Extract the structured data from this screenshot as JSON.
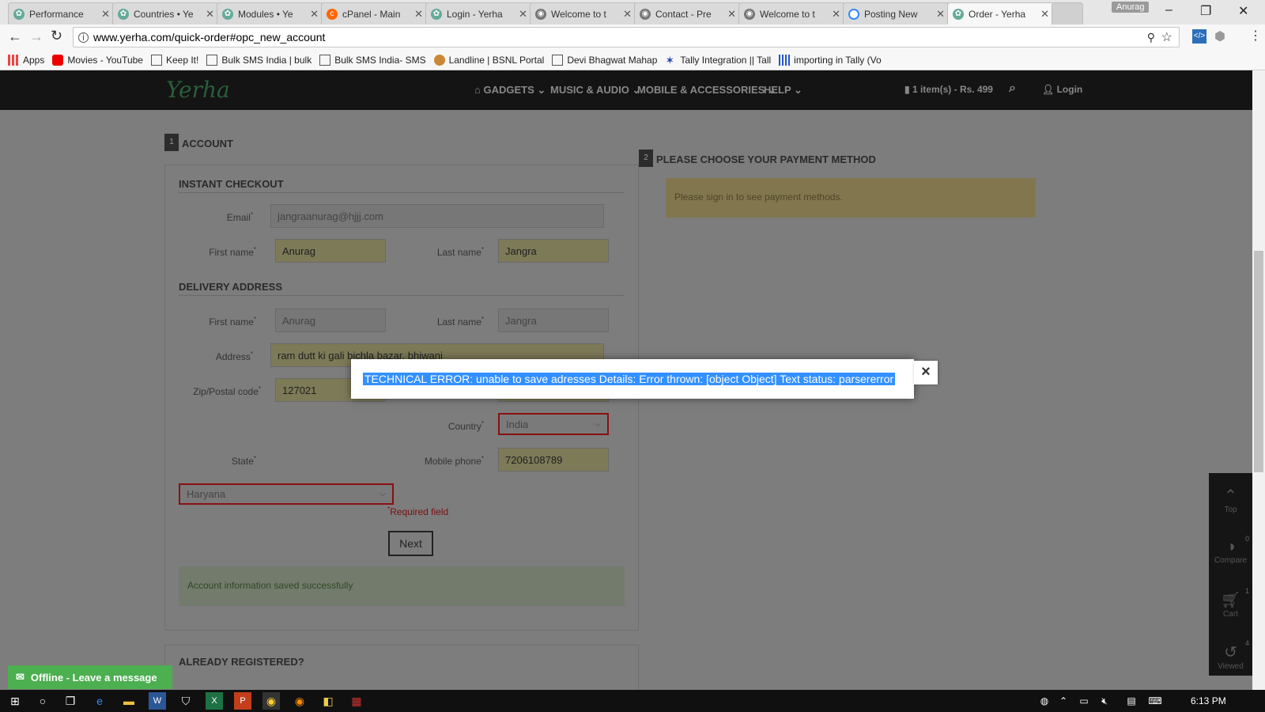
{
  "browser": {
    "tabs": [
      {
        "title": "Performance",
        "icon": "yerha-leaf",
        "color": "#6a9"
      },
      {
        "title": "Countries • Ye",
        "icon": "yerha-leaf",
        "color": "#6a9"
      },
      {
        "title": "Modules • Ye",
        "icon": "yerha-leaf",
        "color": "#6a9"
      },
      {
        "title": "cPanel - Main",
        "icon": "cpanel",
        "color": "#f60"
      },
      {
        "title": "Login - Yerha",
        "icon": "yerha-leaf",
        "color": "#6a9"
      },
      {
        "title": "Welcome to t",
        "icon": "globe",
        "color": "#777"
      },
      {
        "title": "Contact - Pre",
        "icon": "globe",
        "color": "#777"
      },
      {
        "title": "Welcome to t",
        "icon": "globe",
        "color": "#777"
      },
      {
        "title": "Posting New",
        "icon": "loading",
        "color": "#38f"
      },
      {
        "title": "Order - Yerha",
        "icon": "yerha-leaf",
        "color": "#6a9"
      }
    ],
    "profile_name": "Anurag",
    "url": "www.yerha.com/quick-order#opc_new_account",
    "bookmarks": [
      {
        "label": "Apps",
        "icon": "apps-grid"
      },
      {
        "label": "Movies - YouTube",
        "icon": "youtube"
      },
      {
        "label": "Keep It!",
        "icon": "page"
      },
      {
        "label": "Bulk SMS India | bulk",
        "icon": "page"
      },
      {
        "label": "Bulk SMS India- SMS",
        "icon": "page"
      },
      {
        "label": "Landline | BSNL Portal",
        "icon": "bsnl"
      },
      {
        "label": "Devi Bhagwat Mahap",
        "icon": "page"
      },
      {
        "label": "Tally Integration || Tall",
        "icon": "star-blue"
      },
      {
        "label": "importing in Tally (Vo",
        "icon": "bars-blue"
      }
    ]
  },
  "site": {
    "logo": "Yerha",
    "nav": [
      {
        "label": "GADGETS"
      },
      {
        "label": "MUSIC & AUDIO"
      },
      {
        "label": "MOBILE & ACCESSORIES"
      },
      {
        "label": "HELP"
      }
    ],
    "cart_summary": "1 item(s) - Rs. 499",
    "login_label": "Login"
  },
  "account": {
    "step_number": "1",
    "title": "ACCOUNT",
    "instant_checkout": "INSTANT CHECKOUT",
    "email_label": "Email",
    "email_value": "jangraanurag@hjjj.com",
    "first_name_label": "First name",
    "first_name_value": "Anurag",
    "last_name_label": "Last name",
    "last_name_value": "Jangra",
    "delivery_title": "DELIVERY ADDRESS",
    "d_first_name_label": "First name",
    "d_first_name_value": "Anurag",
    "d_last_name_label": "Last name",
    "d_last_name_value": "Jangra",
    "address_label": "Address",
    "address_value": "ram dutt ki gali bichla bazar, bhiwani",
    "zip_label": "Zip/Postal code",
    "zip_value": "127021",
    "country_label": "Country",
    "country_value": "India",
    "state_label": "State",
    "state_value": "Haryana",
    "mobile_label": "Mobile phone",
    "mobile_value": "7206108789",
    "required_note": "Required field",
    "required_star": "*",
    "next_button": "Next",
    "success_message": "Account information saved successfully",
    "already_registered": "ALREADY REGISTERED?"
  },
  "payment": {
    "step_number": "2",
    "title": "PLEASE CHOOSE YOUR PAYMENT METHOD",
    "notice": "Please sign in to see payment methods."
  },
  "modal": {
    "message": "TECHNICAL ERROR: unable to save adresses Details: Error thrown: [object Object] Text status: parsererror",
    "close": "×"
  },
  "side_widget": [
    {
      "label": "Top",
      "icon": "chevron-up-icon",
      "count": ""
    },
    {
      "label": "Compare",
      "icon": "compare-icon",
      "count": "0"
    },
    {
      "label": "Cart",
      "icon": "cart-icon",
      "count": "1"
    },
    {
      "label": "Viewed",
      "icon": "history-icon",
      "count": "4"
    }
  ],
  "chat_label": "Offline - Leave a message",
  "taskbar": {
    "clock": "6:13 PM"
  }
}
